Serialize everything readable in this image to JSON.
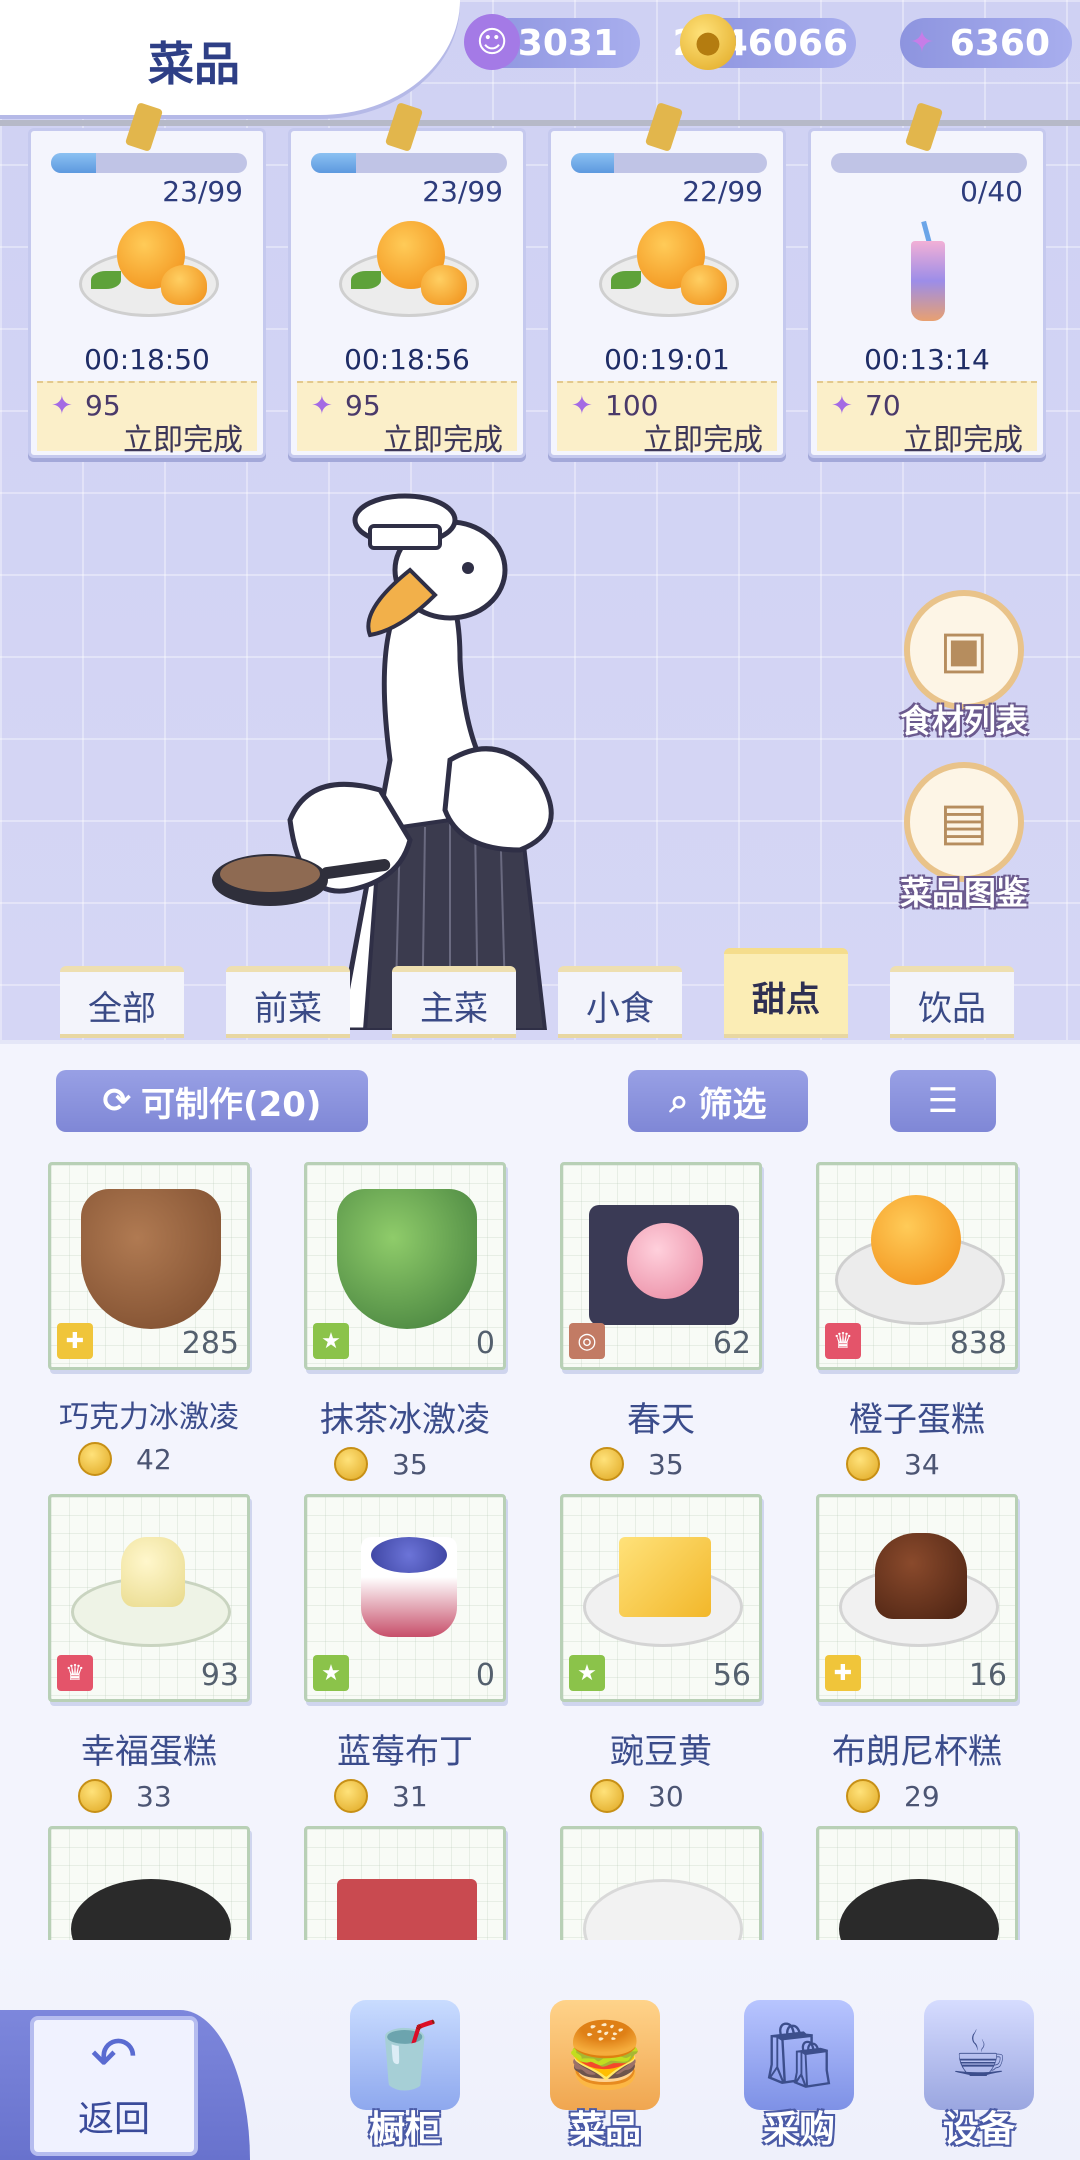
{
  "header": {
    "title": "菜品",
    "resources": [
      {
        "icon": "purple-token-icon",
        "value": "3031"
      },
      {
        "icon": "gold-coin-icon",
        "value": "2746066"
      },
      {
        "icon": "crystal-plus-icon",
        "value": "6360"
      }
    ]
  },
  "orders": [
    {
      "progress": "23/99",
      "fill": 0.23,
      "dish": "orange-cake",
      "timer": "00:18:50",
      "cost": "95",
      "finish_label": "立即完成"
    },
    {
      "progress": "23/99",
      "fill": 0.23,
      "dish": "orange-cake",
      "timer": "00:18:56",
      "cost": "95",
      "finish_label": "立即完成"
    },
    {
      "progress": "22/99",
      "fill": 0.22,
      "dish": "orange-cake",
      "timer": "00:19:01",
      "cost": "100",
      "finish_label": "立即完成"
    },
    {
      "progress": "0/40",
      "fill": 0.0,
      "dish": "drink",
      "timer": "00:13:14",
      "cost": "70",
      "finish_label": "立即完成"
    }
  ],
  "side_buttons": [
    {
      "label": "食材列表",
      "icon": "box-icon"
    },
    {
      "label": "菜品图鉴",
      "icon": "recipe-book-icon"
    }
  ],
  "tabs": [
    "全部",
    "前菜",
    "主菜",
    "小食",
    "甜点",
    "饮品"
  ],
  "active_tab": "甜点",
  "toolbar": {
    "makeable_label": "可制作(20)",
    "filter_label": "筛选"
  },
  "items": [
    {
      "name": "巧克力冰激凌",
      "price": "42",
      "stock": "285",
      "badge": "puzzle",
      "color": "#8a5a3c"
    },
    {
      "name": "抹茶冰激凌",
      "price": "35",
      "stock": "0",
      "badge": "star",
      "color": "#6aa94a"
    },
    {
      "name": "春天",
      "price": "35",
      "stock": "62",
      "badge": "swirl",
      "color": "#f0a5b2"
    },
    {
      "name": "橙子蛋糕",
      "price": "34",
      "stock": "838",
      "badge": "crown",
      "color": "#f39a22"
    },
    {
      "name": "幸福蛋糕",
      "price": "33",
      "stock": "93",
      "badge": "crown",
      "color": "#e6efd2"
    },
    {
      "name": "蓝莓布丁",
      "price": "31",
      "stock": "0",
      "badge": "star",
      "color": "#5b64c8"
    },
    {
      "name": "豌豆黄",
      "price": "30",
      "stock": "56",
      "badge": "star",
      "color": "#f7cf3a"
    },
    {
      "name": "布朗尼杯糕",
      "price": "29",
      "stock": "16",
      "badge": "puzzle",
      "color": "#6b3a22"
    }
  ],
  "nav": {
    "back_label": "返回",
    "items": [
      "橱柜",
      "菜品",
      "采购",
      "设备"
    ]
  }
}
